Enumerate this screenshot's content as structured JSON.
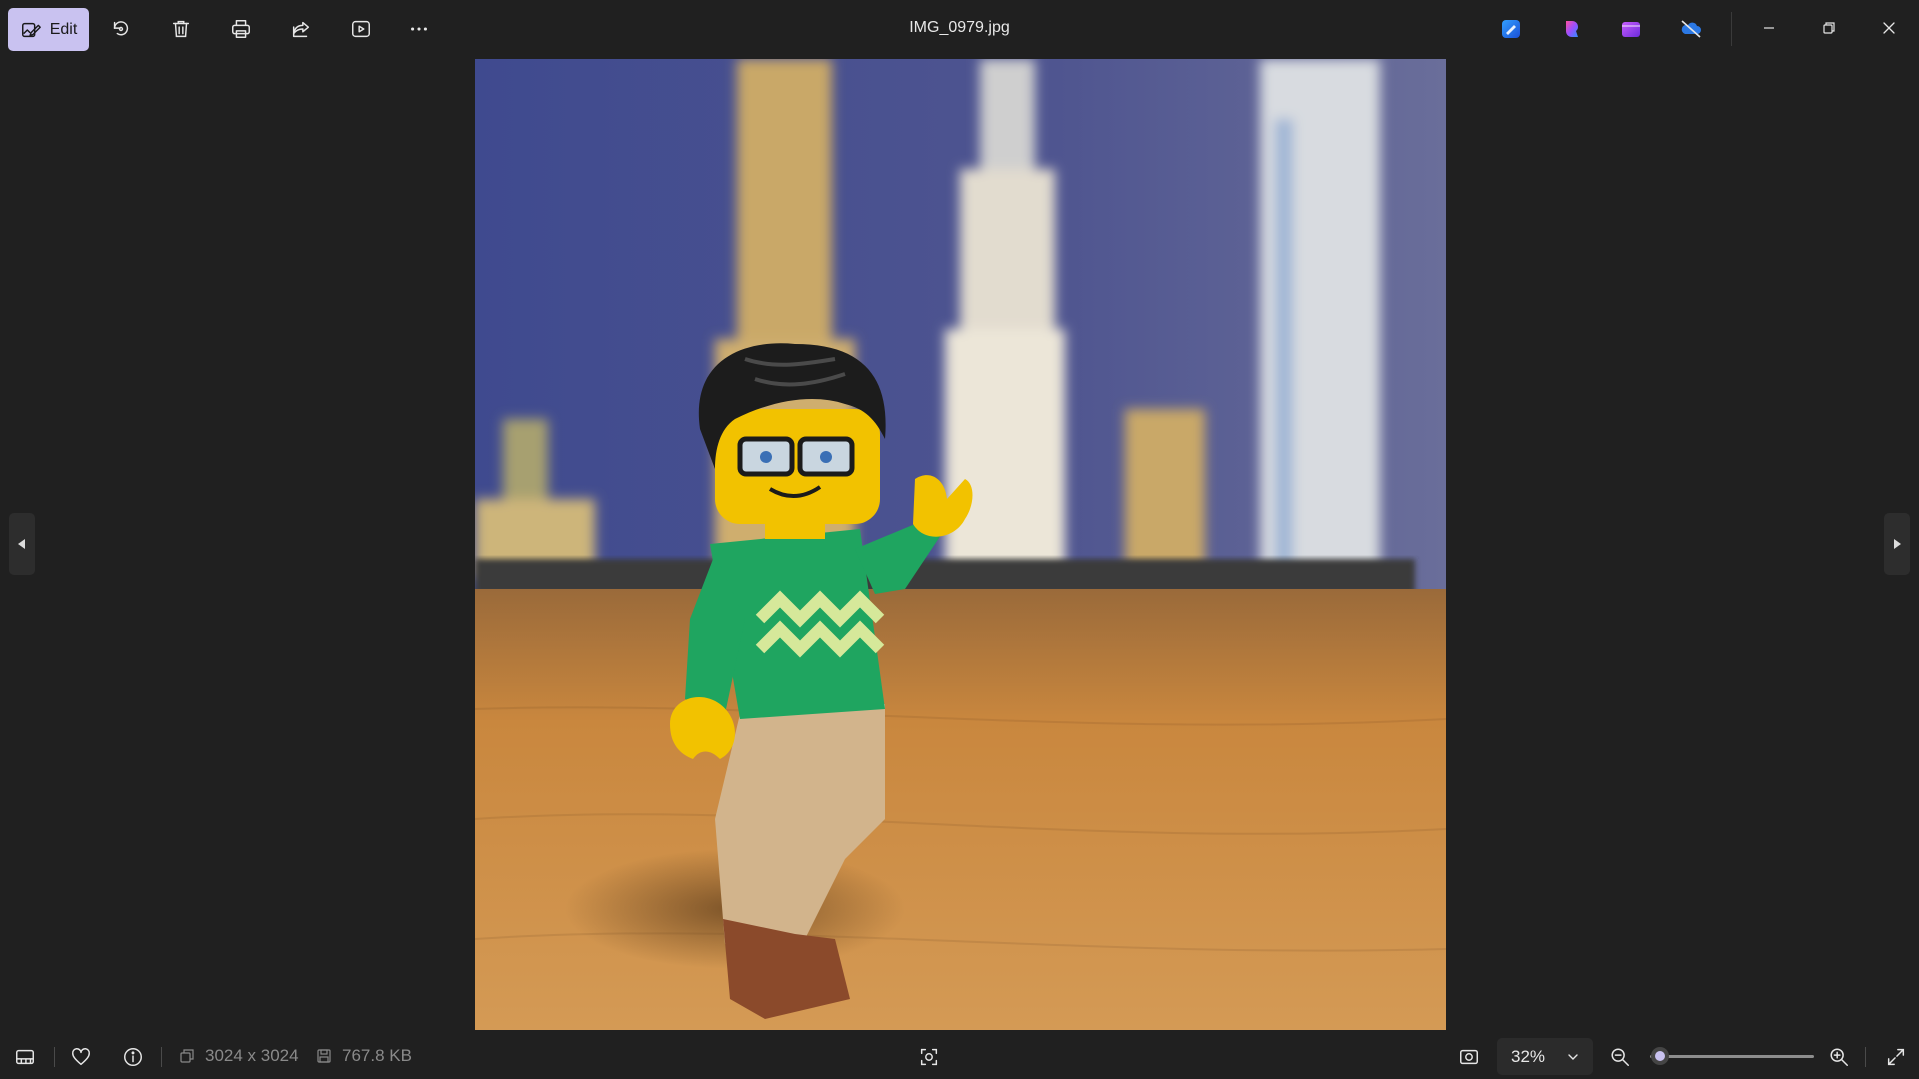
{
  "toolbar": {
    "edit_label": "Edit",
    "file_name": "IMG_0979.jpg",
    "tools": [
      "rotate-icon",
      "delete-icon",
      "print-icon",
      "share-icon",
      "slideshow-icon",
      "more-icon"
    ],
    "apps": [
      "designer-app-icon",
      "copilot-app-icon",
      "clipchamp-app-icon",
      "onedrive-app-icon"
    ],
    "window_controls": [
      "minimize-icon",
      "restore-icon",
      "close-icon"
    ]
  },
  "photo": {
    "description_icon": "lego-minifigure-photo"
  },
  "navigation": {
    "prev": "chevron-left-icon",
    "next": "chevron-right-icon"
  },
  "statusbar": {
    "dimensions": "3024 x 3024",
    "file_size": "767.8 KB",
    "zoom_value": "32%",
    "zoom_slider_fraction": 0.06
  },
  "colors": {
    "accent": "#c9c2f0",
    "background": "#202020"
  }
}
